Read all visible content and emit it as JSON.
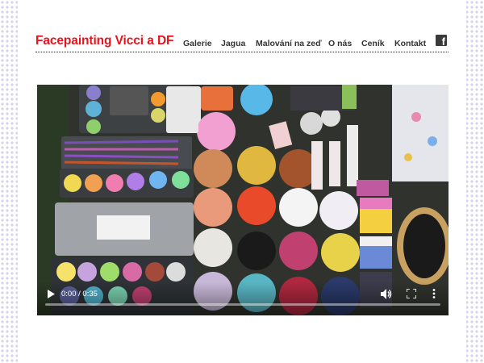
{
  "brand": {
    "title": "Facepainting Vicci a DF",
    "color": "#e8141c"
  },
  "nav": {
    "items": [
      {
        "label": "Galerie"
      },
      {
        "label": "Jagua"
      },
      {
        "label": "Malování na zeď"
      },
      {
        "label": "O nás"
      },
      {
        "label": "Ceník"
      },
      {
        "label": "Kontakt"
      }
    ],
    "social_icon": "facebook-icon"
  },
  "video": {
    "time": "0:00 / 0:35",
    "progress": 0.0,
    "controls": [
      "play-icon",
      "volume-icon",
      "fullscreen-icon",
      "more-options-icon"
    ]
  }
}
